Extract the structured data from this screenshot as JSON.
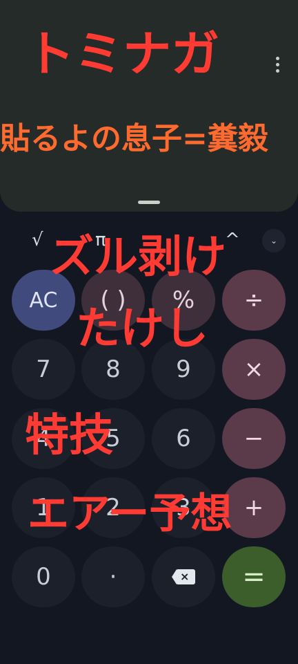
{
  "display": {
    "menu_icon": "more-vertical-icon",
    "handle_icon": "drag-handle-icon"
  },
  "scientific": {
    "sqrt": "√",
    "pi": "π",
    "power": "^",
    "expand_icon": "chevron-down-icon",
    "expand": "⌄"
  },
  "keypad": {
    "ac": "AC",
    "parens": "( )",
    "percent": "%",
    "divide": "÷",
    "seven": "7",
    "eight": "8",
    "nine": "9",
    "multiply": "×",
    "four": "4",
    "five": "5",
    "six": "6",
    "minus": "−",
    "one": "1",
    "two": "2",
    "three": "3",
    "plus": "+",
    "zero": "0",
    "decimal": "·",
    "backspace_icon": "backspace-icon",
    "equals": "="
  },
  "overlay_text": {
    "line1": "トミナガ",
    "line2": "貼るよの息子=糞毅",
    "line3": "ズル剥け",
    "line4": "たけし",
    "line5": "特技",
    "line6": "エアー予想"
  },
  "colors": {
    "overlay_red": "#ff3b33",
    "overlay_orange": "#ff6a2e",
    "ac_key": "#414a7d",
    "operator_key": "#5b3a49",
    "equals_key": "#3c5e2a"
  }
}
